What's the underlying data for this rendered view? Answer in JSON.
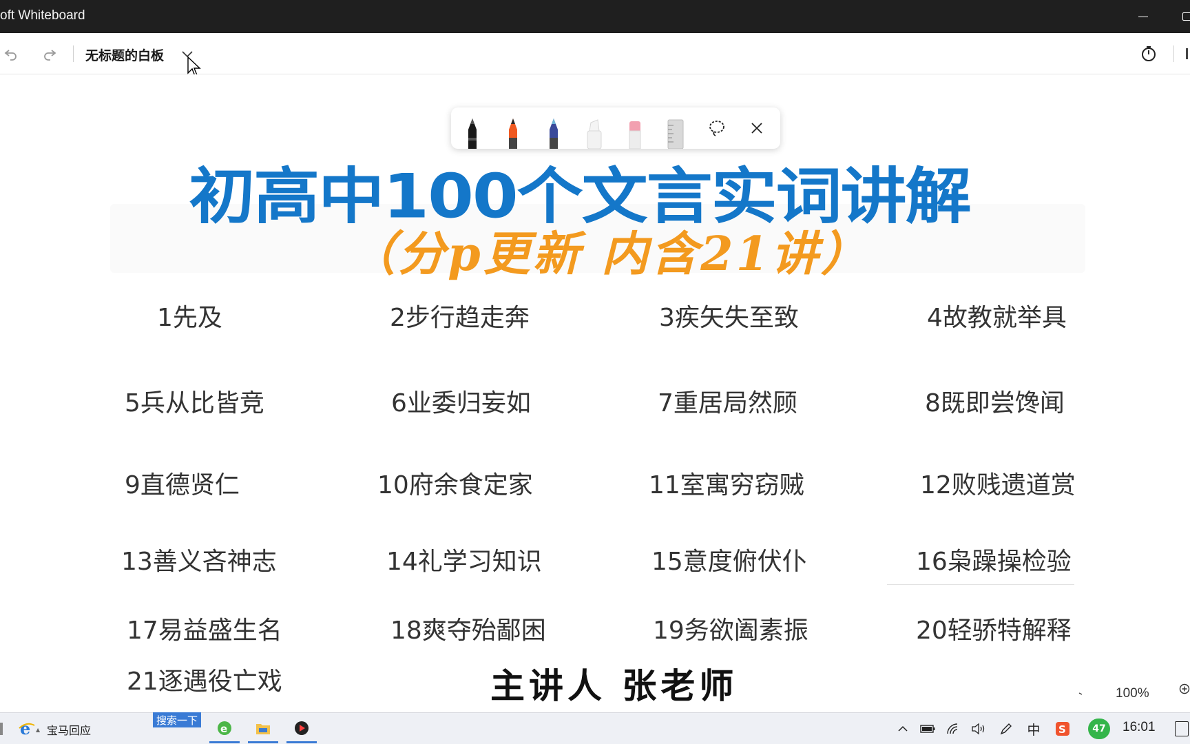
{
  "window": {
    "app_title": "oft Whiteboard"
  },
  "toolbar": {
    "board_title": "无标题的白板"
  },
  "pen_tray": {
    "pens": [
      {
        "name": "black-pen",
        "color": "#1a1a1a"
      },
      {
        "name": "orange-pen",
        "color": "#f05a22"
      },
      {
        "name": "galaxy-pen",
        "color": "#3a4a9a"
      },
      {
        "name": "highlighter",
        "color": "#f2f2f2"
      },
      {
        "name": "eraser",
        "color": "#f2a0b0"
      },
      {
        "name": "ruler",
        "color": "#cfcfcf"
      }
    ]
  },
  "canvas": {
    "main_title": "初高中100个文言实词讲解",
    "sub_title": "（分p更新 内含21讲）",
    "lessons": [
      "1先及",
      "2步行趋走奔",
      "3疾矢失至致",
      "4故教就举具",
      "5兵从比皆竞",
      "6业委归妄如",
      "7重居局然顾",
      "8既即尝馋闻",
      "9直德贤仁",
      "10府余食定家",
      "11室寓穷窃贼",
      "12败贱遗道赏",
      "13善义吝神志",
      "14礼学习知识",
      "15意度俯伏仆",
      "16枭躁操检验",
      "17易益盛生名",
      "18爽夺殆鄙困",
      "19务欲阖素振",
      "20轻骄特解释",
      "21逐遇役亡戏"
    ],
    "presenter": "主讲人 张老师",
    "colors": {
      "title": "#1477c9",
      "subtitle": "#f39a1f"
    }
  },
  "zoom": {
    "level": "100%"
  },
  "taskbar": {
    "app_label": "宝马回应",
    "search_label": "搜索一下",
    "ime": "中",
    "badge": "47",
    "time": "16:01"
  }
}
